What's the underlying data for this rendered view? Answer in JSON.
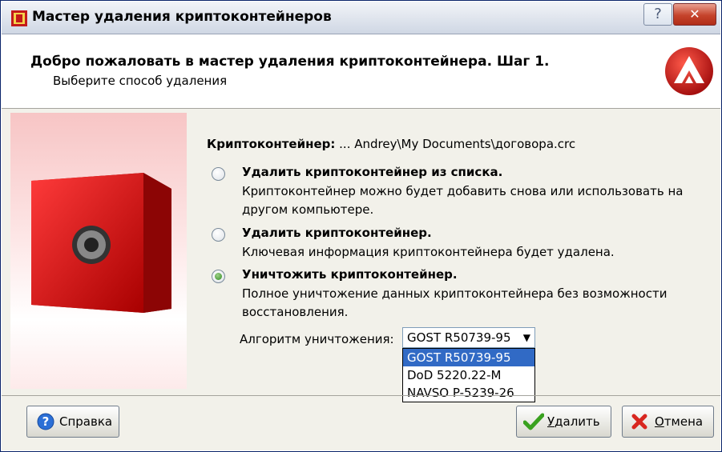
{
  "window": {
    "title": "Мастер удаления криптоконтейнеров"
  },
  "header": {
    "title": "Добро пожаловать в мастер удаления криптоконтейнера. Шаг 1.",
    "subtitle": "Выберите способ удаления"
  },
  "container": {
    "label": "Криптоконтейнер:",
    "path": "... Andrey\\My Documents\\договора.crc"
  },
  "options": [
    {
      "title": "Удалить криптоконтейнер из списка.",
      "desc": "Криптоконтейнер можно будет добавить снова или использовать на другом компьютере.",
      "selected": false
    },
    {
      "title": "Удалить криптоконтейнер.",
      "desc": "Ключевая информация криптоконтейнера будет удалена.",
      "selected": false
    },
    {
      "title": "Уничтожить криптоконтейнер.",
      "desc": "Полное уничтожение данных криптоконтейнера без возможности восстановления.",
      "selected": true
    }
  ],
  "algorithm": {
    "label": "Алгоритм уничтожения:",
    "selected": "GOST R50739-95",
    "options": [
      "GOST R50739-95",
      "DoD 5220.22-M",
      "NAVSO P-5239-26"
    ]
  },
  "buttons": {
    "help": "Справка",
    "delete": "Удалить",
    "cancel": "Отмена"
  },
  "colors": {
    "accent_red": "#d21f1f",
    "selection_blue": "#316ac5",
    "radio_green": "#2f8c1f"
  },
  "icons": [
    "app-icon",
    "help-icon",
    "close-icon",
    "logo-icon",
    "safe-icon",
    "question-icon",
    "check-icon",
    "cancel-x-icon",
    "dropdown-arrow-icon"
  ]
}
